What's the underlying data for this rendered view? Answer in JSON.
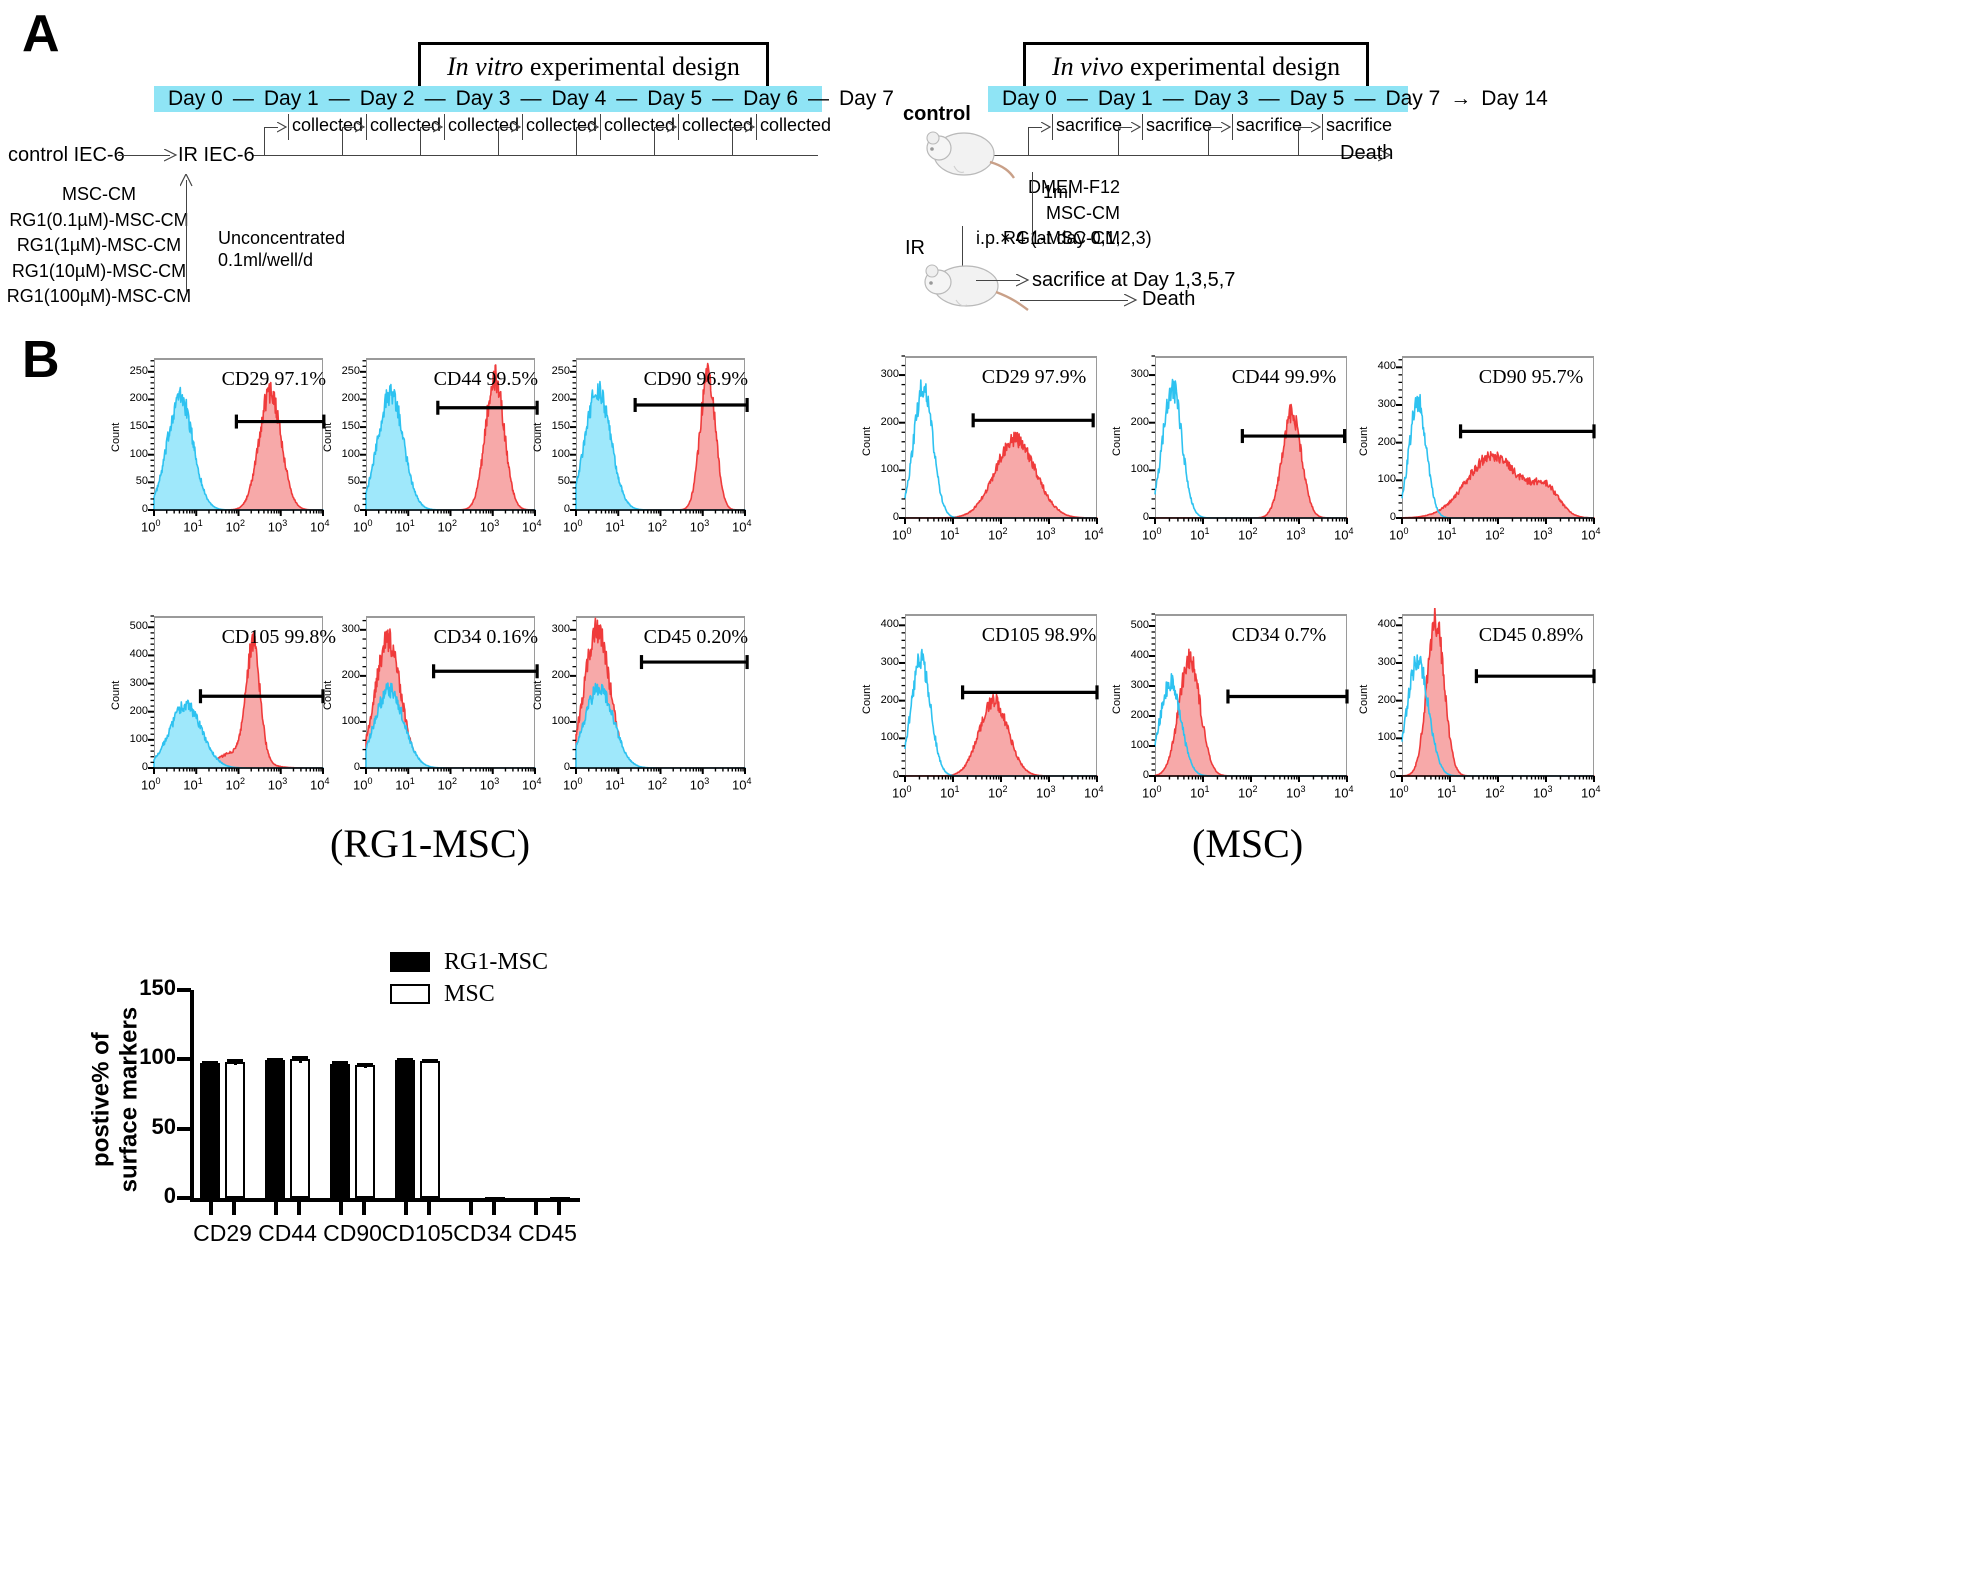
{
  "panels": {
    "a_letter": "A",
    "b_letter": "B"
  },
  "in_vitro": {
    "title_italic": "In vitro",
    "title_rest": " experimental design",
    "days": [
      "Day 0",
      "Day 1",
      "Day 2",
      "Day 3",
      "Day 4",
      "Day 5",
      "Day 6",
      "Day 7"
    ],
    "collected_label": "collected",
    "collected_count": 7,
    "start_label": "control IEC-6",
    "irradiated_label": "IR IEC-6",
    "treatments": [
      "MSC-CM",
      "RG1(0.1µM)-MSC-CM",
      "RG1(1µM)-MSC-CM",
      "RG1(10µM)-MSC-CM",
      "RG1(100µM)-MSC-CM"
    ],
    "dose_line1": "Unconcentrated",
    "dose_line2": "0.1ml/well/d"
  },
  "in_vivo": {
    "title_italic": "In vivo",
    "title_rest": " experimental design",
    "days": [
      "Day 0",
      "Day 1",
      "Day 3",
      "Day 5",
      "Day 7",
      "Day 14"
    ],
    "sacrifice_label": "sacrifice",
    "sacrifice_count": 4,
    "control_label": "control",
    "ir_label": "IR",
    "death_label_top": "Death",
    "death_label_bottom": "Death",
    "agents": [
      "DMEM-F12",
      "MSC-CM",
      "RG1-MSC-CM"
    ],
    "volume": "1ml",
    "route": "i.p.×  4 (at day 0,1,2,3)",
    "sacrifice_days": "sacrifice at Day 1,3,5,7"
  },
  "flow": {
    "ylabel": "Count",
    "xticks": [
      "10",
      "10",
      "10",
      "10",
      "10"
    ],
    "xexp": [
      "0",
      "1",
      "2",
      "3",
      "4"
    ],
    "group_left_label": "(RG1-MSC)",
    "group_right_label": "(MSC)",
    "colors": {
      "control_line": "#2ec2f0",
      "control_fill": "#9fe8fb",
      "sample_line": "#ef3b3b",
      "sample_fill": "#f7a9a9",
      "gate": "#000000",
      "frame": "#9a9a9a"
    },
    "rg1_msc": [
      {
        "marker": "CD29 97.1%",
        "yticks": [
          "250",
          "200",
          "150",
          "100",
          "50",
          "0"
        ],
        "ymax": 275
      },
      {
        "marker": "CD44 99.5%",
        "yticks": [
          "250",
          "200",
          "150",
          "100",
          "50",
          "0"
        ],
        "ymax": 275
      },
      {
        "marker": "CD90 96.9%",
        "yticks": [
          "250",
          "200",
          "150",
          "100",
          "50",
          "0"
        ],
        "ymax": 275
      },
      {
        "marker": "CD105 99.8%",
        "yticks": [
          "500",
          "400",
          "300",
          "200",
          "100",
          "0"
        ],
        "ymax": 540
      },
      {
        "marker": "CD34 0.16%",
        "yticks": [
          "300",
          "200",
          "100",
          "0"
        ],
        "ymax": 330
      },
      {
        "marker": "CD45 0.20%",
        "yticks": [
          "300",
          "200",
          "100",
          "0"
        ],
        "ymax": 330
      }
    ],
    "msc": [
      {
        "marker": "CD29 97.9%",
        "yticks": [
          "300",
          "200",
          "100",
          "0"
        ],
        "ymax": 340
      },
      {
        "marker": "CD44 99.9%",
        "yticks": [
          "300",
          "200",
          "100",
          "0"
        ],
        "ymax": 340
      },
      {
        "marker": "CD90 95.7%",
        "yticks": [
          "400",
          "300",
          "200",
          "100",
          "0"
        ],
        "ymax": 430
      },
      {
        "marker": "CD105 98.9%",
        "yticks": [
          "400",
          "300",
          "200",
          "100",
          "0"
        ],
        "ymax": 430
      },
      {
        "marker": "CD34 0.7%",
        "yticks": [
          "500",
          "400",
          "300",
          "200",
          "100",
          "0"
        ],
        "ymax": 540
      },
      {
        "marker": "CD45 0.89%",
        "yticks": [
          "400",
          "300",
          "200",
          "100",
          "0"
        ],
        "ymax": 430
      }
    ]
  },
  "chart_data": {
    "type": "bar",
    "title": "",
    "ylabel": "postive% of\nsurface markers",
    "xlabel": "",
    "categories": [
      "CD29",
      "CD44",
      "CD90",
      "CD105",
      "CD34",
      "CD45"
    ],
    "ylim": [
      0,
      150
    ],
    "yticks": [
      0,
      50,
      100,
      150
    ],
    "grid": false,
    "legend_position": "top-right",
    "series": [
      {
        "name": "RG1-MSC",
        "color": "#000000",
        "values": [
          97.1,
          99.5,
          96.9,
          99.8,
          0.16,
          0.2
        ],
        "errors": [
          2.0,
          1.6,
          1.8,
          1.2,
          0.1,
          0.1
        ]
      },
      {
        "name": "MSC",
        "color": "#ffffff",
        "values": [
          97.9,
          99.9,
          95.7,
          98.9,
          0.7,
          0.89
        ],
        "errors": [
          2.2,
          2.4,
          1.7,
          1.5,
          0.2,
          0.2
        ]
      }
    ]
  }
}
